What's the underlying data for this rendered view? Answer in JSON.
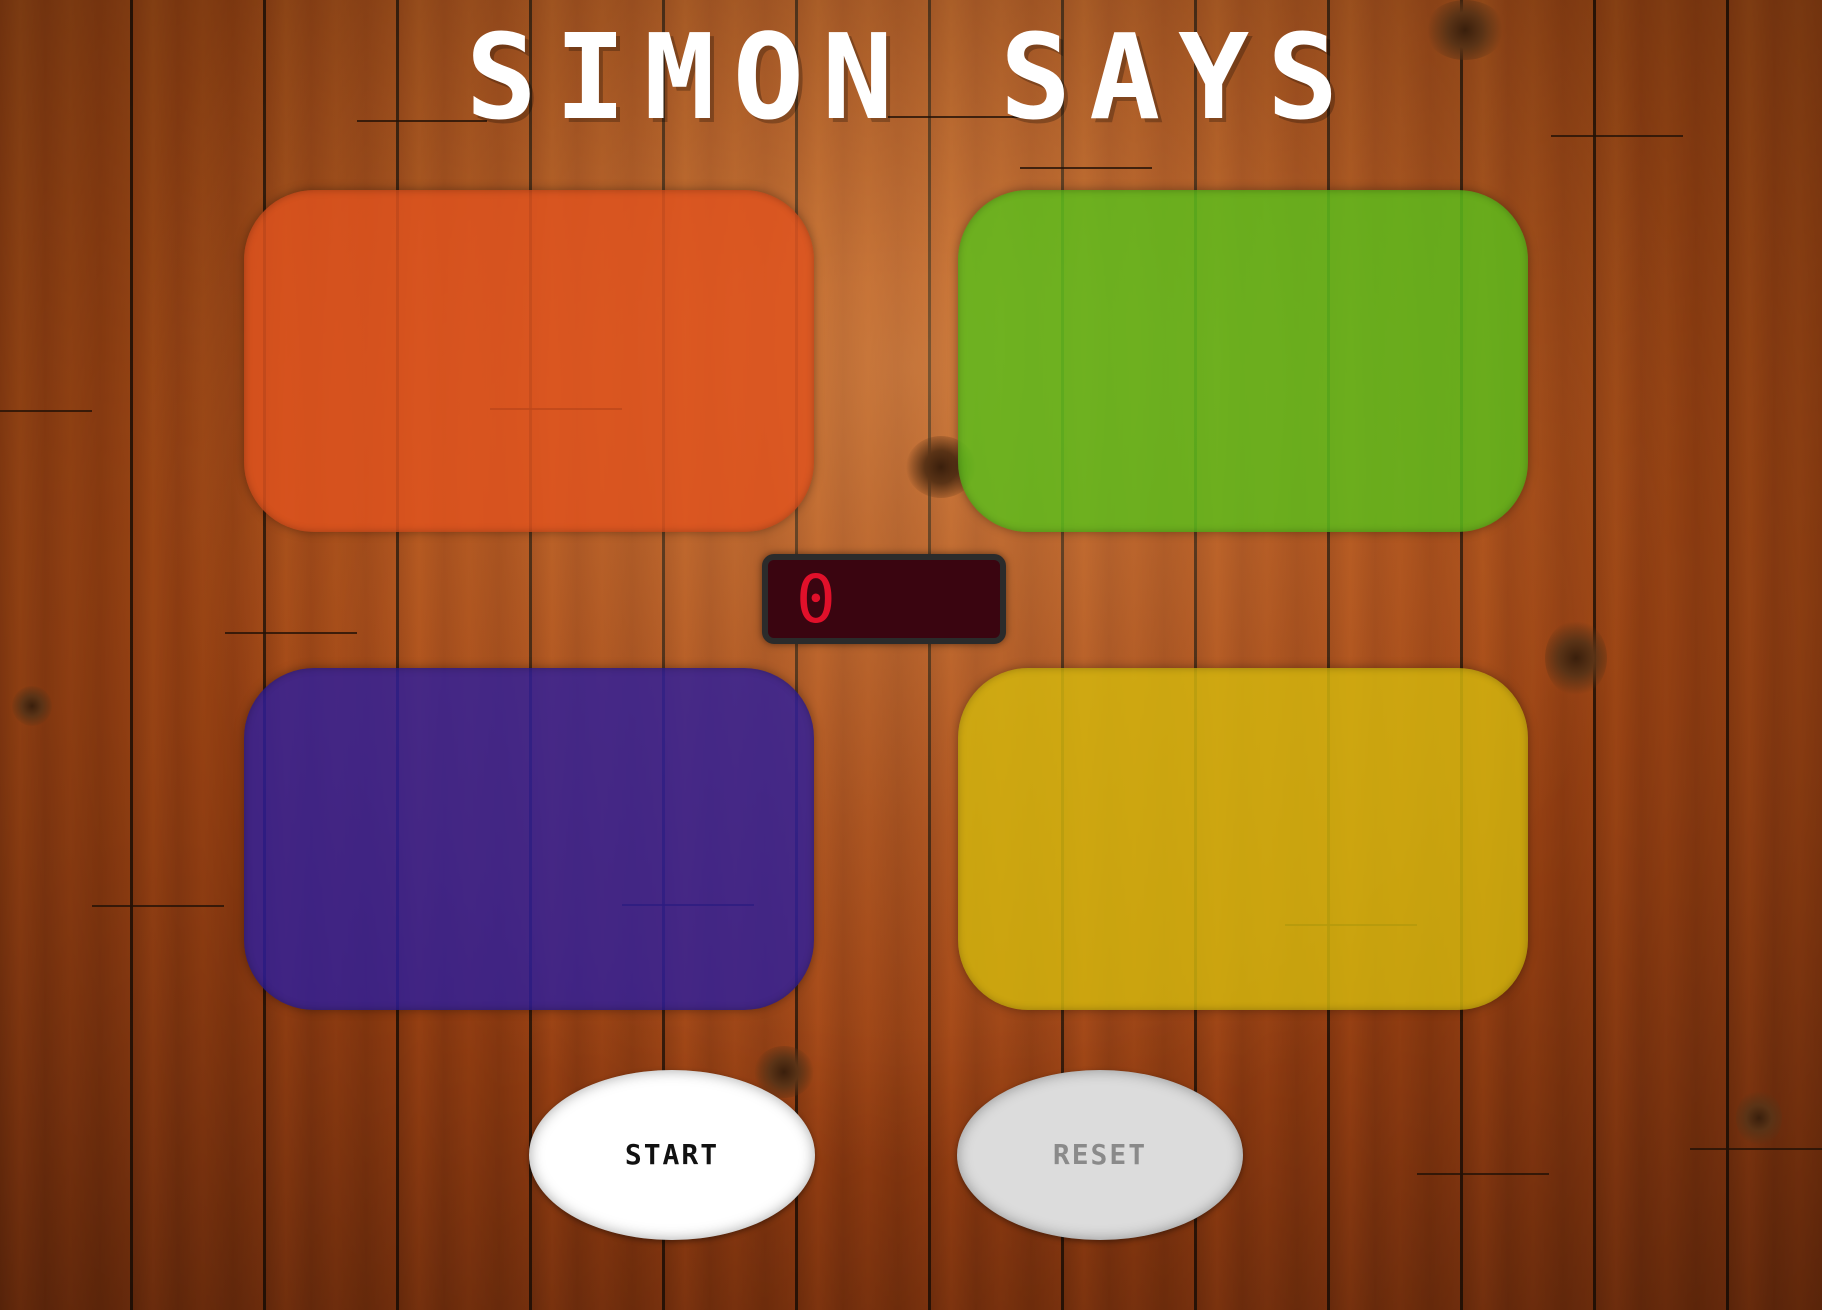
{
  "title": "SIMON SAYS",
  "pads": [
    {
      "name": "red",
      "color": "#e0531e"
    },
    {
      "name": "green",
      "color": "#5cbf1c"
    },
    {
      "name": "blue",
      "color": "#2e1f9c"
    },
    {
      "name": "yellow",
      "color": "#d4b80e"
    }
  ],
  "counter": {
    "value": "0",
    "color": "#e0102a",
    "background": "#3a0510"
  },
  "controls": {
    "start_label": "START",
    "reset_label": "RESET"
  }
}
